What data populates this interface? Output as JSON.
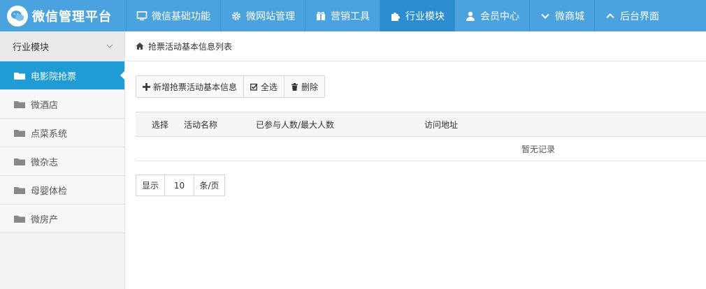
{
  "brand": {
    "title": "微信管理平台",
    "logo_icon": "wechat-logo-icon"
  },
  "nav": {
    "items": [
      {
        "label": "微信基础功能",
        "icon": "monitor-icon"
      },
      {
        "label": "微网站管理",
        "icon": "gear-icon"
      },
      {
        "label": "营销工具",
        "icon": "gift-icon"
      },
      {
        "label": "行业模块",
        "icon": "puzzle-icon",
        "active": true
      },
      {
        "label": "会员中心",
        "icon": "user-icon"
      },
      {
        "label": "微商城",
        "icon": "chevron-down-icon"
      },
      {
        "label": "后台界面",
        "icon": "chevron-up-icon"
      }
    ]
  },
  "sidebar": {
    "header": "行业模块",
    "items": [
      {
        "label": "电影院抢票",
        "active": true
      },
      {
        "label": "微酒店"
      },
      {
        "label": "点菜系统"
      },
      {
        "label": "微杂志"
      },
      {
        "label": "母婴体检"
      },
      {
        "label": "微房产"
      }
    ]
  },
  "breadcrumb": {
    "text": "抢票活动基本信息列表",
    "icon": "home-icon"
  },
  "toolbar": {
    "add_label": "新增抢票活动基本信息",
    "select_all_label": "全选",
    "delete_label": "删除"
  },
  "table": {
    "columns": [
      "选择",
      "活动名称",
      "已参与人数/最大人数",
      "访问地址"
    ],
    "empty_text": "暂无记录"
  },
  "pager": {
    "prefix": "显示",
    "page_size": "10",
    "suffix": "条/页"
  },
  "colors": {
    "topbar": "#4aa3de",
    "nav_active": "#2b8ccf",
    "sidebar_active": "#1f9bd6"
  }
}
